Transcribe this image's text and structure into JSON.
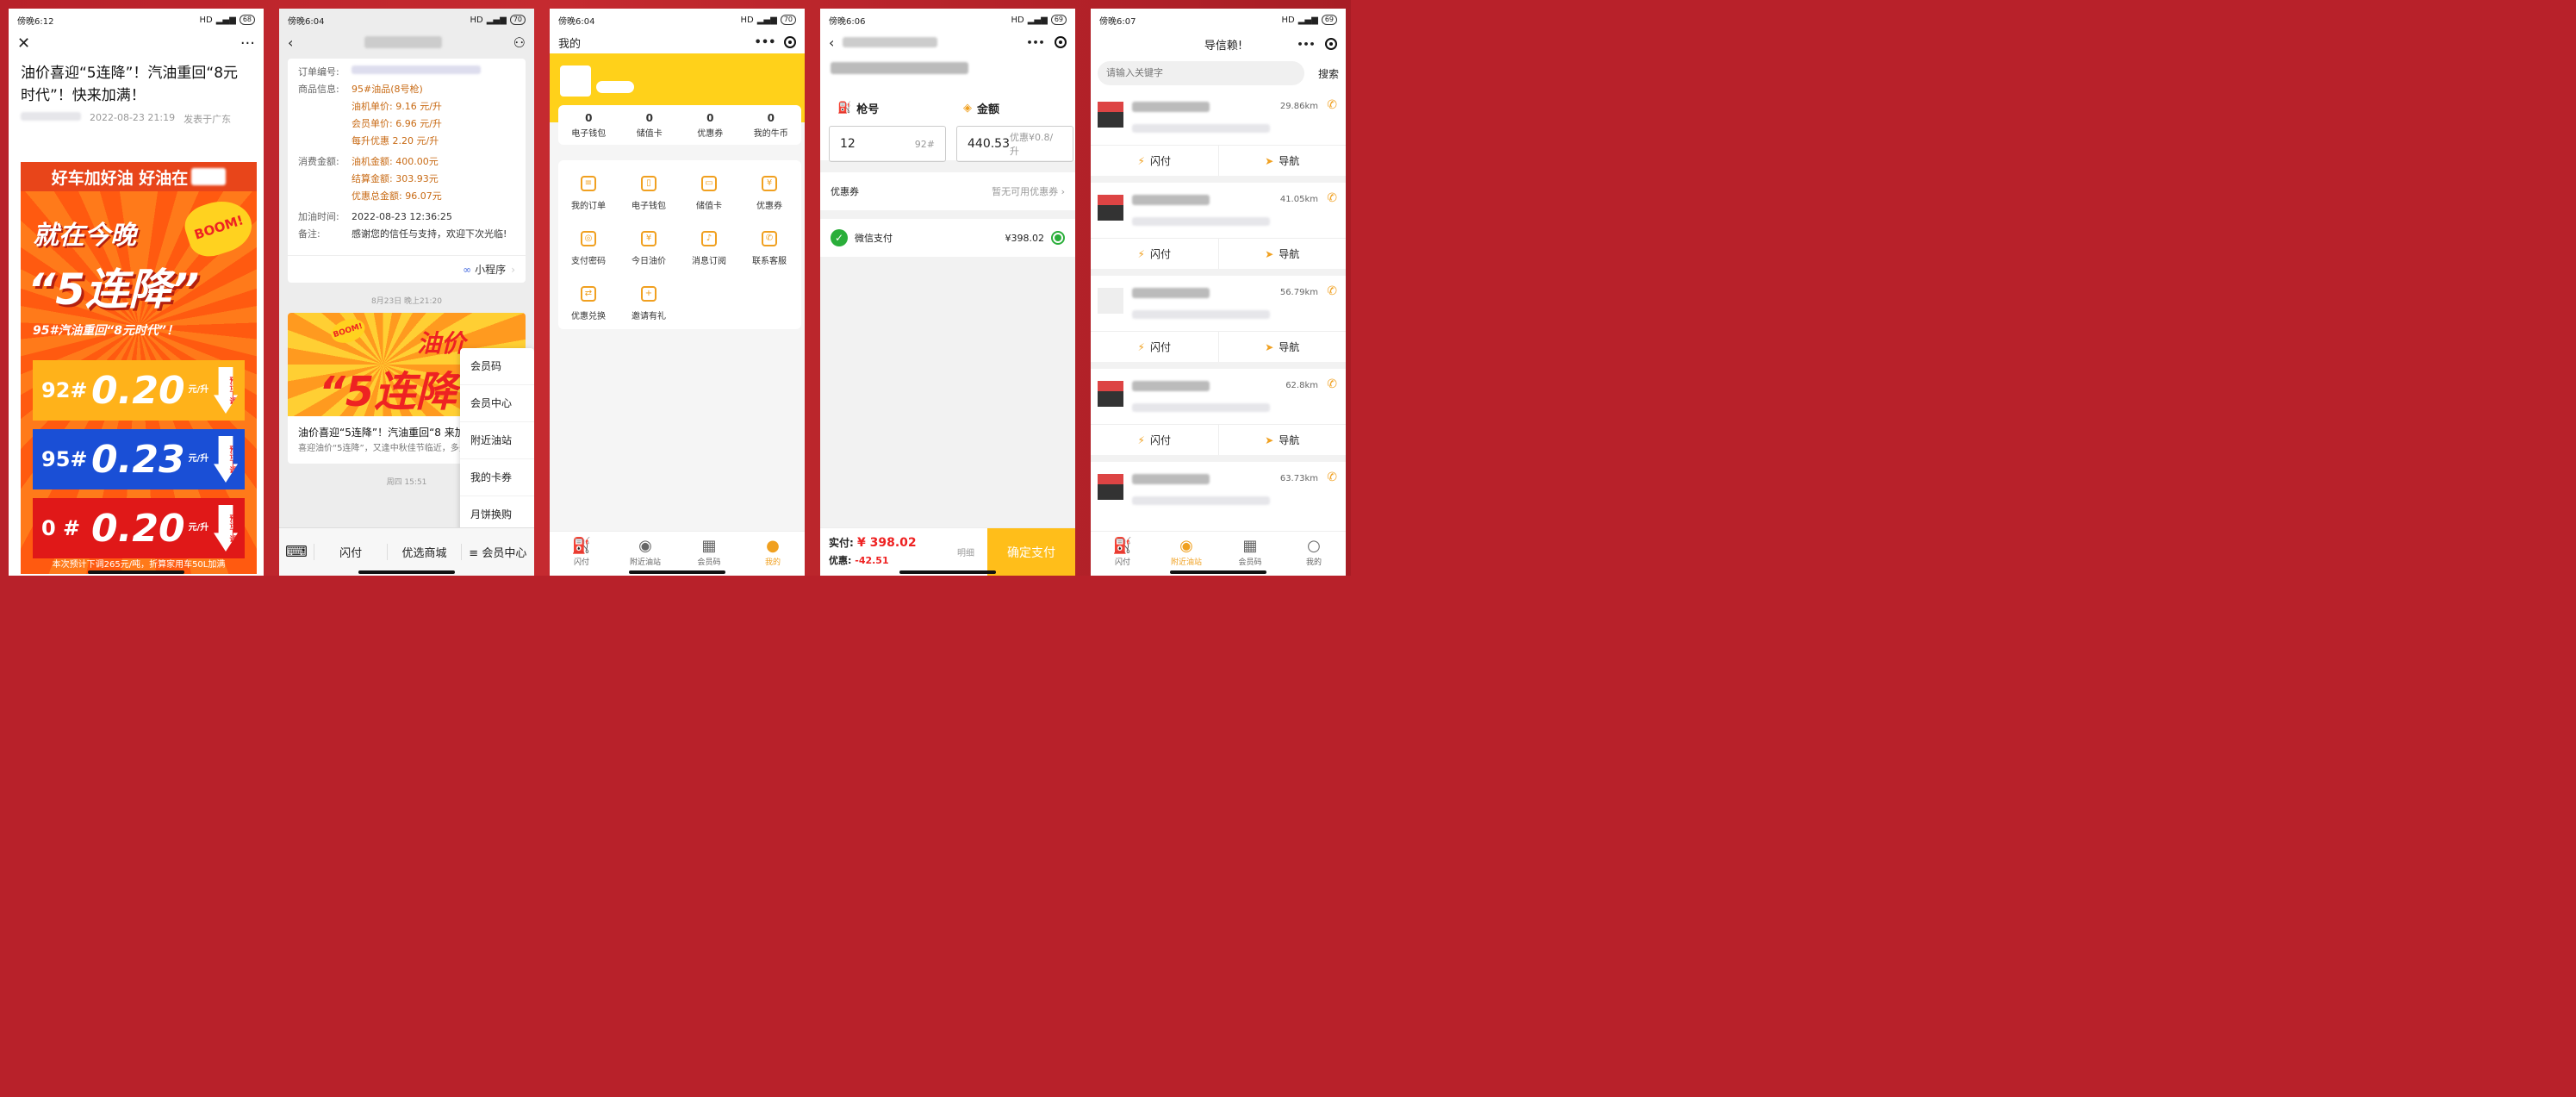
{
  "phone1": {
    "status": {
      "time": "傍晚6:12",
      "battery": "68"
    },
    "title": "油价喜迎“5连降”！汽油重回“8元时代”！快来加满！",
    "date": "2022-08-23 21:19",
    "location": "发表于广东",
    "poster": {
      "banner": "好车加好油 好油在",
      "line1": "就在今晚",
      "boom": "BOOM!",
      "line2": "“5连降”",
      "line3": "95#汽油重回“8元时代”！",
      "rows": [
        {
          "grade": "92#",
          "value": "0.20",
          "unit": "元/升",
          "tag": "预计下调"
        },
        {
          "grade": "95#",
          "value": "0.23",
          "unit": "元/升",
          "tag": "预计下调"
        },
        {
          "grade": "0 #",
          "value": "0.20",
          "unit": "元/升",
          "tag": "预计下调"
        }
      ],
      "footer": "本次预计下调265元/吨，折算家用车50L加满"
    }
  },
  "phone2": {
    "status": {
      "time": "傍晚6:04",
      "battery": "70"
    },
    "order": [
      {
        "k": "订单编号:",
        "v": ""
      },
      {
        "k": "商品信息:",
        "v": "95#油品(8号枪)"
      },
      {
        "k": "",
        "v": "油机单价: 9.16 元/升"
      },
      {
        "k": "",
        "v": "会员单价: 6.96 元/升"
      },
      {
        "k": "",
        "v": "每升优惠 2.20 元/升"
      },
      {
        "k": "消费金额:",
        "v": "油机金额: 400.00元"
      },
      {
        "k": "",
        "v": "结算金额: 303.93元"
      },
      {
        "k": "",
        "v": "优惠总金额: 96.07元"
      },
      {
        "k": "加油时间:",
        "v": "2022-08-23 12:36:25"
      },
      {
        "k": "备注:",
        "v": "感谢您的信任与支持，欢迎下次光临!"
      }
    ],
    "mini_program": "小程序",
    "time1": "8月23日 晚上21:20",
    "article": {
      "img_line1": "油价",
      "img_line2": "“5连降",
      "boom": "BOOM!",
      "title": "油价喜迎“5连降”！汽油重回“8 来加满!",
      "desc": "喜迎油价“5连降”，又逢中秋佳节临近，多多，快来加满!"
    },
    "time2": "周四 15:51",
    "popmenu": [
      "会员码",
      "会员中心",
      "附近油站",
      "我的卡券",
      "月饼换购"
    ],
    "bottom": [
      "闪付",
      "优选商城",
      "≡ 会员中心"
    ]
  },
  "phone3": {
    "status": {
      "time": "傍晚6:04",
      "battery": "70"
    },
    "title": "我的",
    "stats": [
      {
        "n": "0",
        "l": "电子钱包"
      },
      {
        "n": "0",
        "l": "储值卡"
      },
      {
        "n": "0",
        "l": "优惠券"
      },
      {
        "n": "0",
        "l": "我的牛币"
      }
    ],
    "grid": [
      "我的订单",
      "电子钱包",
      "储值卡",
      "优惠券",
      "支付密码",
      "今日油价",
      "消息订阅",
      "联系客服",
      "优惠兑换",
      "邀请有礼"
    ],
    "tabs": [
      "闪付",
      "附近油站",
      "会员码",
      "我的"
    ]
  },
  "phone4": {
    "status": {
      "time": "傍晚6:06",
      "battery": "69"
    },
    "gun_label": "枪号",
    "amount_label": "金额",
    "gun_value": "12",
    "gun_grade": "92#",
    "amount_value": "440.53",
    "amount_discount": "优惠¥0.8/升",
    "coupon_label": "优惠券",
    "coupon_value": "暂无可用优惠券",
    "wechat_pay": "微信支付",
    "wechat_amount": "¥398.02",
    "pay_label": "实付:",
    "pay_value": "¥ 398.02",
    "discount_label": "优惠:",
    "discount_value": "-42.51",
    "detail": "明细",
    "confirm": "确定支付"
  },
  "phone5": {
    "status": {
      "time": "傍晚6:07",
      "battery": "69"
    },
    "title": "导信赖!",
    "search_placeholder": "请输入关键字",
    "search_btn": "搜索",
    "stations": [
      {
        "km": "29.86km"
      },
      {
        "km": "41.05km"
      },
      {
        "km": "56.79km"
      },
      {
        "km": "62.8km"
      },
      {
        "km": "63.73km"
      }
    ],
    "flash": "闪付",
    "navigate": "导航",
    "tabs": [
      "闪付",
      "附近油站",
      "会员码",
      "我的"
    ]
  }
}
